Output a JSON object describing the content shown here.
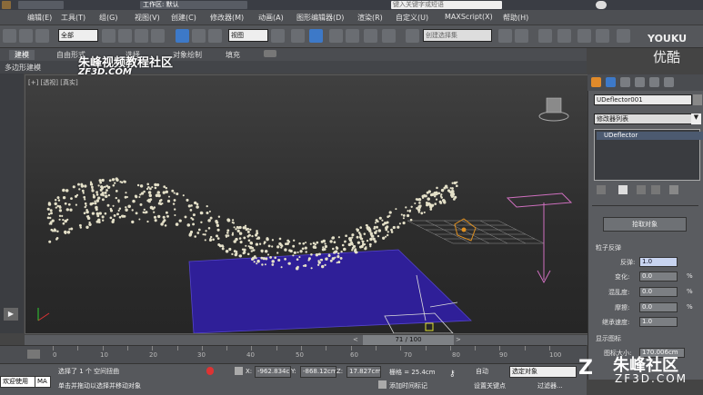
{
  "titlebar": {
    "workspace": "工作区: 默认",
    "search_placeholder": "键入关键字或短语"
  },
  "menu": [
    "编辑(E)",
    "工具(T)",
    "组(G)",
    "视图(V)",
    "创建(C)",
    "修改器(M)",
    "动画(A)",
    "图形编辑器(D)",
    "渲染(R)",
    "自定义(U)",
    "MAXScript(X)",
    "帮助(H)"
  ],
  "toolbar": {
    "filter_value": "全部",
    "view_dropdown": "视图",
    "selection_set_placeholder": "创建选择集"
  },
  "ribbon": {
    "tabs": [
      "建模",
      "自由形式",
      "选择",
      "对象绘制",
      "填充"
    ],
    "sub_tab": "多边形建模"
  },
  "viewport": {
    "label": "[+] [透视] [真实]"
  },
  "command_panel": {
    "object_name": "UDeflector001",
    "modifier_list": "修改器列表",
    "stack_item": "UDeflector",
    "pick_object_button": "拾取对象",
    "rollout_particle": "粒子反弹",
    "params": [
      {
        "label": "反弹:",
        "value": "1.0",
        "unit": ""
      },
      {
        "label": "变化:",
        "value": "0.0",
        "unit": "%"
      },
      {
        "label": "混乱度:",
        "value": "0.0",
        "unit": "%"
      },
      {
        "label": "摩擦:",
        "value": "0.0",
        "unit": "%"
      },
      {
        "label": "继承速度:",
        "value": "1.0",
        "unit": ""
      }
    ],
    "rollout_display": "显示图标",
    "icon_size_label": "图标大小:",
    "icon_size_value": "170.006cm"
  },
  "timeline": {
    "frame": "71 / 100",
    "ticks": [
      "0",
      "10",
      "20",
      "30",
      "40",
      "50",
      "60",
      "70",
      "80",
      "90",
      "100"
    ]
  },
  "status": {
    "welcome": "欢迎使用",
    "maxscript": "MA",
    "selected_text": "选择了 1 个 空间扭曲",
    "hint_text": "单击并拖动以选择并移动对象",
    "x_label": "X:",
    "x_value": "-962.834c",
    "y_label": "Y:",
    "y_value": "-868.12cm",
    "z_label": "Z:",
    "z_value": "17.827cm",
    "grid": "栅格 = 25.4cm",
    "add_time_tag": "添加时间标记",
    "auto_key": "自动",
    "selected_object": "选定对象",
    "set_key": "设置关键点",
    "key_filters": "过滤器..."
  },
  "watermarks": {
    "zhufeng": "朱峰视频教程社区",
    "zf3d": "ZF3D.COM",
    "youku": "YOUKU",
    "youku_cn": "优酷",
    "community": "朱峰社区",
    "community_url": "ZF3D.COM"
  }
}
